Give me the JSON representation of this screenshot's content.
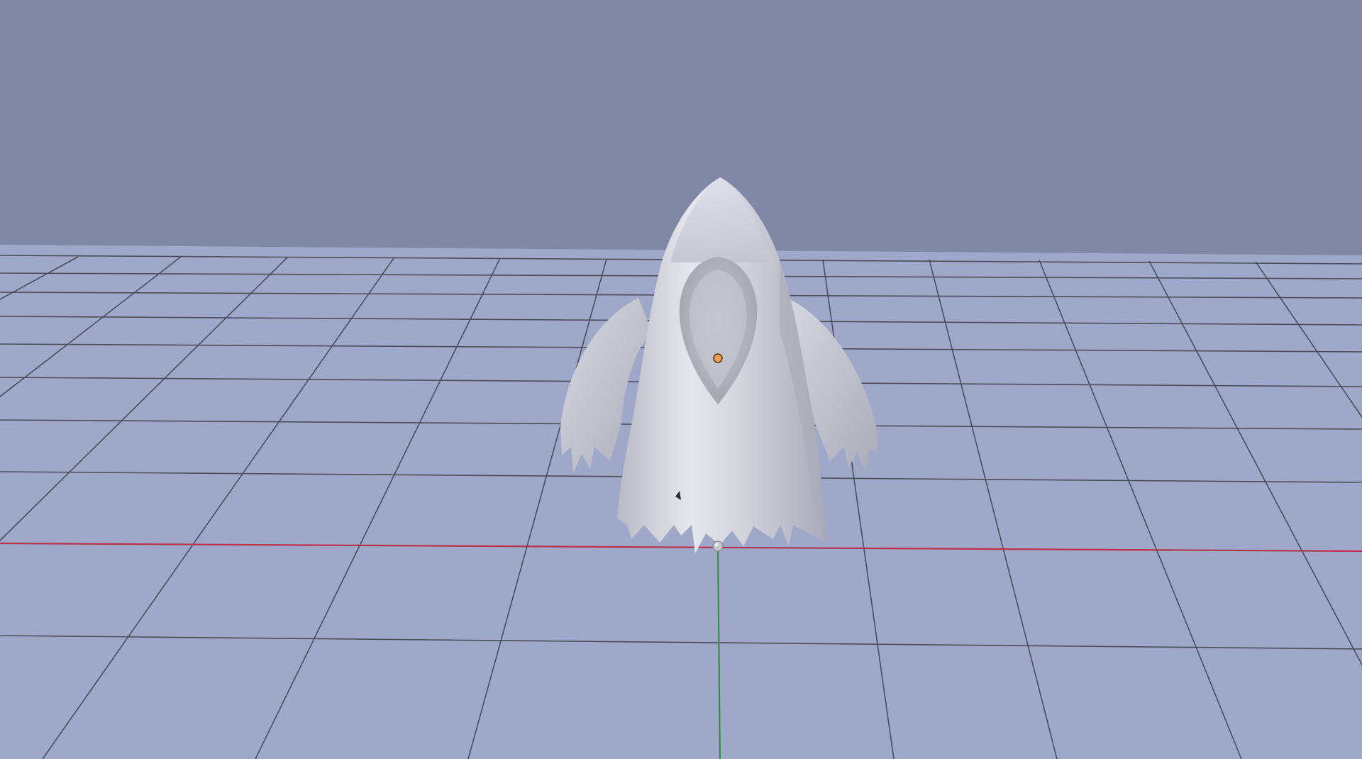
{
  "app": {
    "view": "3d-viewport"
  },
  "scene": {
    "background_color": "#8088a6",
    "floor_color": "#9fa8c8",
    "grid_line_color": "#4a4e5a",
    "x_axis_color": "#b8324a",
    "y_axis_color": "#2f8a3f",
    "grid_visible": true,
    "model": {
      "name": "ghost",
      "color": "#dcdde3",
      "shadow_color": "#a9acb8",
      "selected": true
    },
    "origin_marker": {
      "icon": "object-origin-icon",
      "color": "#f0a050"
    },
    "pivot_marker": {
      "icon": "pivot-ball-icon",
      "color": "#c8c8cc"
    }
  }
}
